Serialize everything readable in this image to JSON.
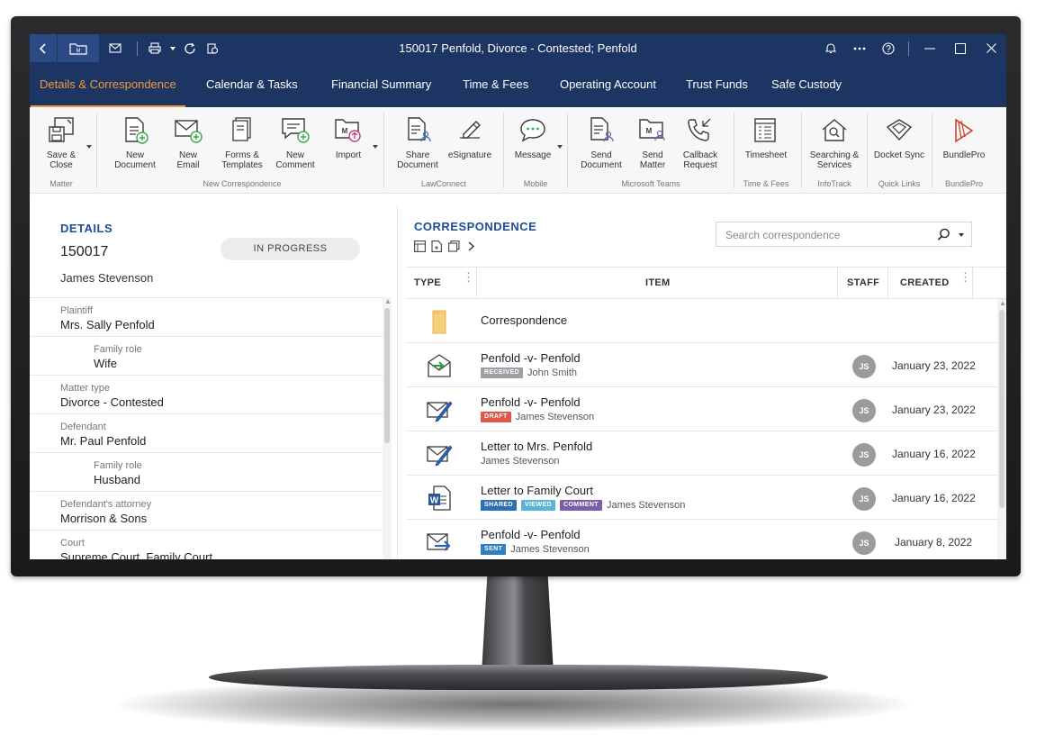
{
  "window": {
    "title": "150017 Penfold, Divorce - Contested; Penfold",
    "matter_badge": "M"
  },
  "tabs": [
    {
      "label": "Details & Correspondence",
      "active": true
    },
    {
      "label": "Calendar & Tasks"
    },
    {
      "label": "Financial Summary"
    },
    {
      "label": "Time & Fees"
    },
    {
      "label": "Operating Account"
    },
    {
      "label": "Trust Funds"
    },
    {
      "label": "Safe Custody"
    }
  ],
  "ribbon": {
    "items": [
      {
        "label": "Save &\nClose",
        "icon": "save-close-icon"
      },
      {
        "label": "New\nDocument",
        "icon": "new-document-icon"
      },
      {
        "label": "New\nEmail",
        "icon": "new-email-icon"
      },
      {
        "label": "Forms &\nTemplates",
        "icon": "forms-templates-icon"
      },
      {
        "label": "New\nComment",
        "icon": "new-comment-icon"
      },
      {
        "label": "Import",
        "icon": "import-icon"
      },
      {
        "label": "Share\nDocument",
        "icon": "share-document-icon"
      },
      {
        "label": "eSignature",
        "icon": "esignature-icon"
      },
      {
        "label": "Message",
        "icon": "message-icon"
      },
      {
        "label": "Send\nDocument",
        "icon": "send-document-icon"
      },
      {
        "label": "Send\nMatter",
        "icon": "send-matter-icon"
      },
      {
        "label": "Callback\nRequest",
        "icon": "callback-request-icon"
      },
      {
        "label": "Timesheet",
        "icon": "timesheet-icon"
      },
      {
        "label": "Searching &\nServices",
        "icon": "searching-services-icon"
      },
      {
        "label": "Docket Sync",
        "icon": "docket-sync-icon"
      },
      {
        "label": "BundlePro",
        "icon": "bundlepro-icon"
      }
    ],
    "groups": [
      "Matter",
      "New Correspondence",
      "LawConnect",
      "Mobile",
      "Microsoft Teams",
      "Time & Fees",
      "InfoTrack",
      "Quick Links",
      "BundlePro"
    ]
  },
  "details": {
    "title": "DETAILS",
    "matter_number": "150017",
    "status": "IN PROGRESS",
    "client": "James Stevenson",
    "fields": [
      {
        "label": "Plaintiff",
        "value": "Mrs. Sally Penfold",
        "sub": false
      },
      {
        "label": "Family role",
        "value": "Wife",
        "sub": true
      },
      {
        "label": "Matter type",
        "value": "Divorce - Contested",
        "sub": false
      },
      {
        "label": "Defendant",
        "value": "Mr. Paul Penfold",
        "sub": false
      },
      {
        "label": "Family role",
        "value": "Husband",
        "sub": true
      },
      {
        "label": "Defendant's attorney",
        "value": "Morrison & Sons",
        "sub": false
      },
      {
        "label": "Court",
        "value": "Supreme Court, Family Court",
        "sub": false
      }
    ]
  },
  "correspondence": {
    "title": "CORRESPONDENCE",
    "search_placeholder": "Search correspondence",
    "columns": {
      "type": "TYPE",
      "item": "ITEM",
      "staff": "STAFF",
      "created": "CREATED"
    },
    "rows": [
      {
        "icon": "folder-icon",
        "title": "Correspondence",
        "badges": [],
        "person": "",
        "staff": "",
        "date": ""
      },
      {
        "icon": "received-email-icon",
        "title": "Penfold -v- Penfold",
        "badges": [
          {
            "text": "RECEIVED",
            "color": "#9aa0a6"
          }
        ],
        "person": "John Smith",
        "staff": "JS",
        "date": "January 23, 2022"
      },
      {
        "icon": "draft-email-icon",
        "title": "Penfold -v- Penfold",
        "badges": [
          {
            "text": "DRAFT",
            "color": "#e0574a"
          }
        ],
        "person": "James Stevenson",
        "staff": "JS",
        "date": "January 23, 2022"
      },
      {
        "icon": "draft-email-icon",
        "title": "Letter to Mrs. Penfold",
        "badges": [],
        "person": "James Stevenson",
        "staff": "JS",
        "date": "January 16, 2022"
      },
      {
        "icon": "word-document-icon",
        "title": "Letter to Family Court",
        "badges": [
          {
            "text": "SHARED",
            "color": "#2f6fb5"
          },
          {
            "text": "VIEWED",
            "color": "#5ab4d6"
          },
          {
            "text": "COMMENT",
            "color": "#7b5ea9"
          }
        ],
        "person": "James Stevenson",
        "staff": "JS",
        "date": "January 16, 2022"
      },
      {
        "icon": "sent-email-icon",
        "title": "Penfold -v- Penfold",
        "badges": [
          {
            "text": "SENT",
            "color": "#2f7fc1"
          }
        ],
        "person": "James Stevenson",
        "staff": "JS",
        "date": "January 8, 2022"
      }
    ]
  },
  "colors": {
    "titlebar": "#1d3562",
    "accent": "#f39a3c",
    "heading": "#1f4c96"
  }
}
